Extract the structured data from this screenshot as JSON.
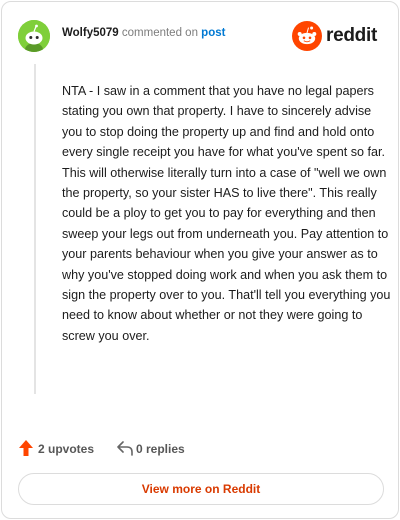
{
  "header": {
    "username": "Wolfy5079",
    "action_text": "commented on",
    "post_link": "post",
    "brand": "reddit"
  },
  "comment": {
    "body": "NTA - I saw in a comment that you have no legal papers stating you own that property. I have to sincerely advise you to stop doing the property up and find and hold onto every single receipt you have for what you've spent so far. This will otherwise literally turn into a case of \"well we own the property, so your sister HAS to live there\". This really could be a ploy to get you to pay for everything and then sweep your legs out from underneath you. Pay attention to your parents behaviour when you give your answer as to why you've stopped doing work and when you ask them to sign the property over to you. That'll tell you everything you need to know about whether or not they were going to screw you over."
  },
  "actions": {
    "upvotes_label": "2 upvotes",
    "replies_label": "0 replies"
  },
  "footer": {
    "view_more_label": "View more on Reddit"
  },
  "colors": {
    "brand_orange": "#ff4500",
    "link_blue": "#0079d3",
    "avatar_green": "#7fcf3a",
    "view_more_text": "#d93a00"
  },
  "icons": {
    "avatar": "snoo-avatar-icon",
    "logo": "reddit-snoo-icon",
    "upvote": "upvote-arrow-icon",
    "reply": "reply-arrow-icon"
  }
}
